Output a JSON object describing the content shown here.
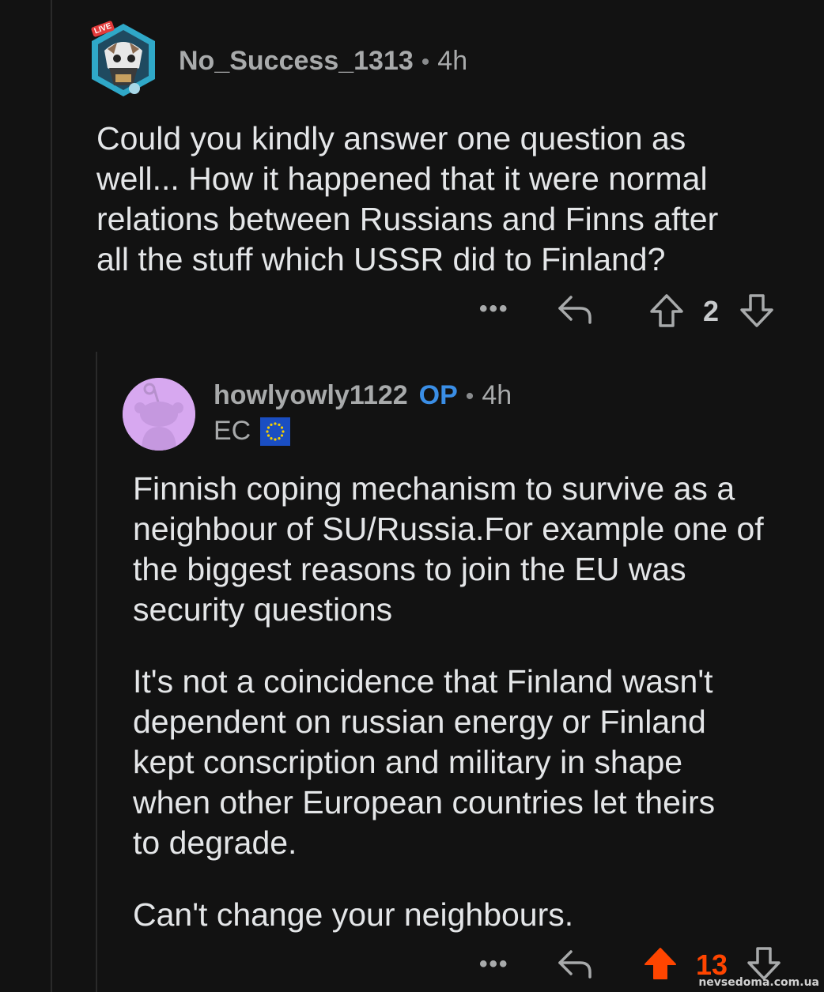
{
  "comment1": {
    "username": "No_Success_1313",
    "separator": "•",
    "time": "4h",
    "body_lines": [
      "Could you kindly answer one question as",
      "well... How it happened that it were normal",
      "relations between Russians and Finns after",
      "all the stuff which USSR did to Finland?"
    ],
    "actions": {
      "more_label": "•••",
      "reply_icon": "reply-icon",
      "upvote_icon": "upvote-arrow-icon",
      "score": "2",
      "downvote_icon": "downvote-arrow-icon"
    },
    "avatar_badge": "LIVE"
  },
  "comment2": {
    "username": "howlyowly1122",
    "op_badge": "OP",
    "separator": "•",
    "time": "4h",
    "flair_text": "EC",
    "flair_icon": "eu-flag-icon",
    "paragraphs": [
      [
        "Finnish coping mechanism to survive as a",
        "neighbour of SU/Russia.For example one of",
        "the biggest reasons to join the EU was",
        "security questions"
      ],
      [
        "It's not a coincidence that Finland wasn't",
        "dependent on russian energy or Finland",
        "kept conscription and military in shape",
        "when other European countries let theirs",
        "to degrade."
      ],
      [
        "Can't change your neighbours."
      ]
    ],
    "actions": {
      "more_label": "•••",
      "reply_icon": "reply-icon",
      "upvote_icon": "upvote-arrow-filled-icon",
      "score": "13",
      "downvote_icon": "downvote-arrow-icon"
    }
  },
  "watermark": "nevsedoma.com.ua",
  "colors": {
    "background": "#121212",
    "op_blue": "#3a8ee6",
    "upvote_orange": "#ff4500",
    "avatar_lilac": "#d7a8f0"
  }
}
